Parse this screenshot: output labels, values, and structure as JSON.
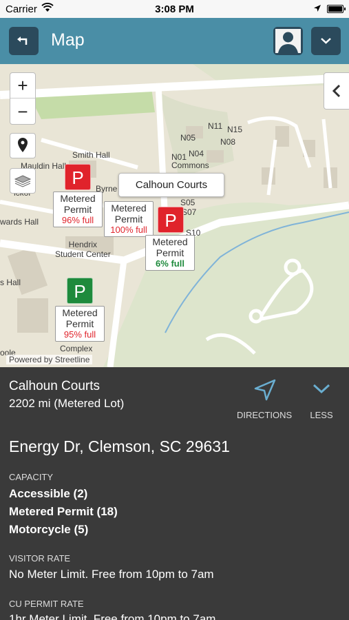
{
  "status_bar": {
    "carrier": "Carrier",
    "time": "3:08 PM"
  },
  "header": {
    "title": "Map"
  },
  "map": {
    "labels": {
      "smith_hall": "Smith Hall",
      "mauldin_hall": "Mauldin Hall",
      "byrnes": "Byrne",
      "edwards_hall": "wards Hall",
      "hickory": "ickor",
      "hendrix": "Hendrix\nStudent Center",
      "s_hall": "s Hall",
      "poole": "oole",
      "complex": "Complex",
      "n11": "N11",
      "n15": "N15",
      "n05": "N05",
      "n08": "N08",
      "n04": "N04",
      "n01": "N01",
      "commons": "Commons",
      "s05": "S05",
      "s07": "S07",
      "s10": "S10"
    },
    "markers": [
      {
        "type": "Metered",
        "kind": "Permit",
        "full": "96% full",
        "color": "#e0232b"
      },
      {
        "type": "Metered",
        "kind": "Permit",
        "full": "100% full",
        "color": "#e0232b"
      },
      {
        "type": "Metered",
        "kind": "Permit",
        "full": "6% full",
        "color": "#1e8a3c"
      },
      {
        "type": "Metered",
        "kind": "Permit",
        "full": "95% full",
        "color": "#e0232b"
      }
    ],
    "marker_letter": "P",
    "callout": "Calhoun Courts",
    "attribution": "Powered by Streetline",
    "zoom_in": "+",
    "zoom_out": "−"
  },
  "details": {
    "name": "Calhoun Courts",
    "distance": "2202 mi (Metered Lot)",
    "directions_label": "DIRECTIONS",
    "less_label": "LESS",
    "address": "Energy Dr, Clemson, SC 29631",
    "capacity_label": "CAPACITY",
    "capacity": [
      "Accessible (2)",
      "Metered Permit (18)",
      "Motorcycle (5)"
    ],
    "visitor_rate_label": "VISITOR RATE",
    "visitor_rate": "No Meter Limit. Free from 10pm to 7am",
    "cu_permit_rate_label": "CU PERMIT RATE",
    "cu_permit_rate": "1hr Meter Limit. Free from 10pm to 7am"
  },
  "colors": {
    "header": "#4a8ea6",
    "button": "#2b4a5c",
    "panel": "#3a3a3a",
    "red": "#e0232b",
    "green": "#1e8a3c"
  }
}
